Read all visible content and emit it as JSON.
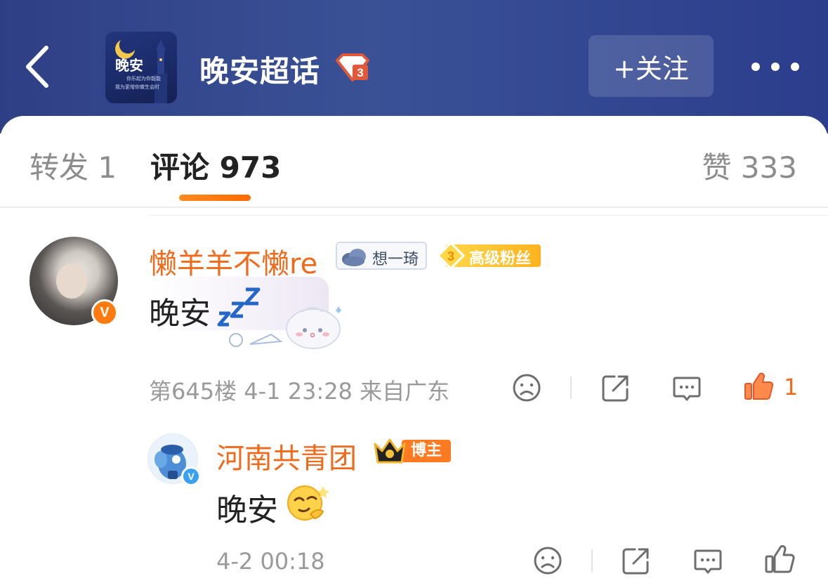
{
  "header": {
    "topic_title": "晚安超话",
    "thumb_title": "晚安",
    "thumb_line1": "你乐起为你能能",
    "thumb_line2": "我为更增你做生会时",
    "level": "3",
    "follow_label": "+关注"
  },
  "tabs": {
    "repost": "转发 1",
    "comments": "评论 973",
    "likes": "赞 333"
  },
  "comments": [
    {
      "username": "懒羊羊不懒re",
      "verified_glyph": "V",
      "fan_badge": "想一琦",
      "level_badge_num": "3",
      "level_badge_text": "高级粉丝",
      "text": "晚安",
      "meta": "第645楼 4-1 23:28 来自广东",
      "like_count": "1"
    }
  ],
  "reply": {
    "username": "河南共青团",
    "verified_glyph": "V",
    "role_tag": "博主",
    "text": "晚安",
    "meta": "4-2 00:18"
  },
  "colors": {
    "header_bg": "#3a5196",
    "accent_orange": "#f06a1c",
    "tab_indicator": "#ff7a10"
  }
}
